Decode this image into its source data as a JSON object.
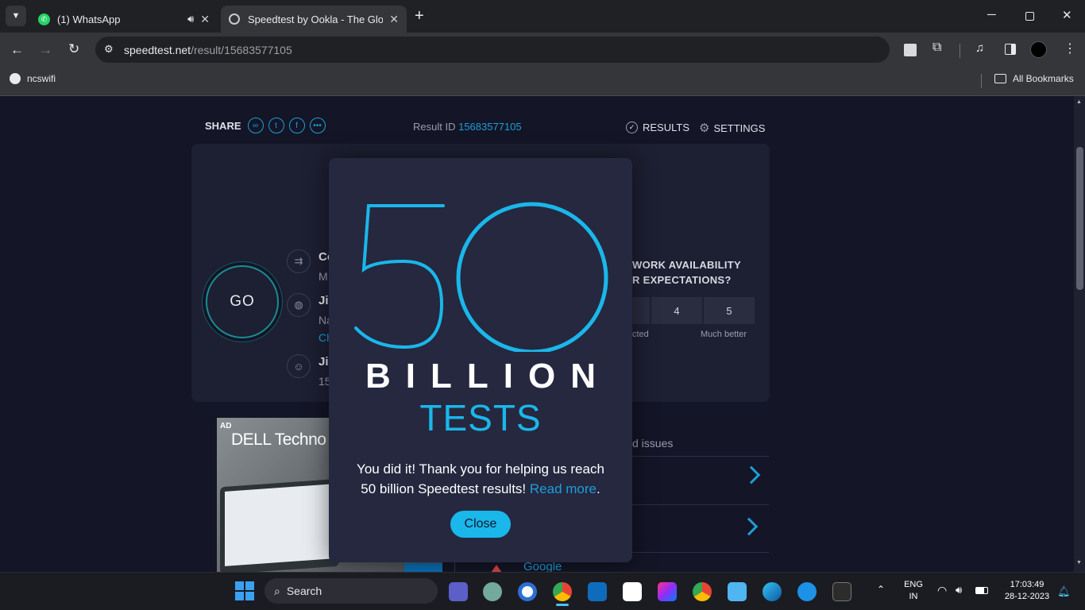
{
  "browser": {
    "tabs": [
      {
        "title": "(1) WhatsApp",
        "icon": "whatsapp-icon",
        "active": false
      },
      {
        "title": "Speedtest by Ookla - The Global Broadband Speed Test",
        "icon": "ookla-icon",
        "active": true
      }
    ],
    "address_host": "speedtest.net",
    "address_path": "/result/15683577105",
    "bookmark": "ncswifi",
    "all_bookmarks": "All Bookmarks"
  },
  "page": {
    "share_label": "SHARE",
    "result_label": "Result ID",
    "result_id": "15683577105",
    "results_label": "RESULTS",
    "settings_label": "SETTINGS",
    "go_label": "GO",
    "conn_rows": [
      {
        "line1": "Co",
        "line2": "M"
      },
      {
        "line1": "Jio",
        "line2": "Na",
        "line3": "Ch"
      },
      {
        "line1": "Jio",
        "line2": "15"
      }
    ],
    "survey_line1": "WORK AVAILABILITY",
    "survey_line2": "R EXPECTATIONS?",
    "ratings": [
      "4",
      "5"
    ],
    "rating_low_label": "cted",
    "rating_high_label": "Much better",
    "ad_badge": "AD",
    "ad_brand": "DELL Techno",
    "issues_label": "d issues",
    "google_label": "Google"
  },
  "modal": {
    "big_number": "50",
    "word1": "BILLION",
    "word2": "TESTS",
    "message_line1": "You did it! Thank you for helping us reach",
    "message_line2_prefix": "50 billion Speedtest results!",
    "read_more": "Read more",
    "period": ".",
    "close_label": "Close"
  },
  "taskbar": {
    "search_placeholder": "Search",
    "lang_line1": "ENG",
    "lang_line2": "IN",
    "time": "17:03:49",
    "date": "28-12-2023"
  },
  "colors": {
    "accent": "#1ab7ea",
    "page_bg": "#141526",
    "modal_bg": "#262840",
    "link": "#1c9ed8"
  }
}
